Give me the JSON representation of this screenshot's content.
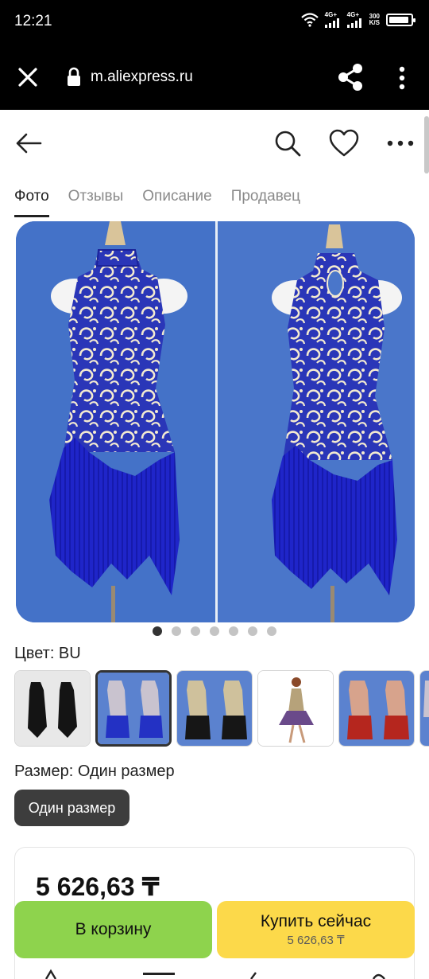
{
  "status_bar": {
    "time": "12:21",
    "signal1": "4G+",
    "signal2": "4G+",
    "speed_value": "300",
    "speed_unit": "K/S",
    "battery_icon": "battery-icon"
  },
  "browser": {
    "url": "m.aliexpress.ru",
    "close_icon": "close-icon",
    "lock_icon": "lock-icon",
    "share_icon": "share-icon",
    "menu_icon": "more-vertical-icon"
  },
  "header": {
    "back_icon": "arrow-left-icon",
    "search_icon": "search-icon",
    "favorite_icon": "heart-icon",
    "more_icon": "more-horizontal-icon"
  },
  "tabs": [
    {
      "label": "Фото",
      "active": true
    },
    {
      "label": "Отзывы",
      "active": false
    },
    {
      "label": "Описание",
      "active": false
    },
    {
      "label": "Продавец",
      "active": false
    }
  ],
  "gallery": {
    "dot_count": 7,
    "active_index": 0
  },
  "color": {
    "label": "Цвет: BU",
    "options": [
      {
        "variant": "black",
        "selected": false
      },
      {
        "variant": "blue",
        "selected": true
      },
      {
        "variant": "black-gold",
        "selected": false
      },
      {
        "variant": "model-photo",
        "selected": false
      },
      {
        "variant": "red",
        "selected": false
      },
      {
        "variant": "blue-partial",
        "selected": false
      }
    ]
  },
  "size": {
    "label": "Размер: Один размер",
    "option": "Один размер"
  },
  "price": {
    "value": "5 626,63 ₸"
  },
  "actions": {
    "cart_label": "В корзину",
    "buy_label": "Купить сейчас",
    "buy_price": "5 626,63 ₸"
  },
  "colors": {
    "accent_green": "#8ed34d",
    "accent_yellow": "#fcd94a",
    "product_blue": "#2233c4"
  }
}
